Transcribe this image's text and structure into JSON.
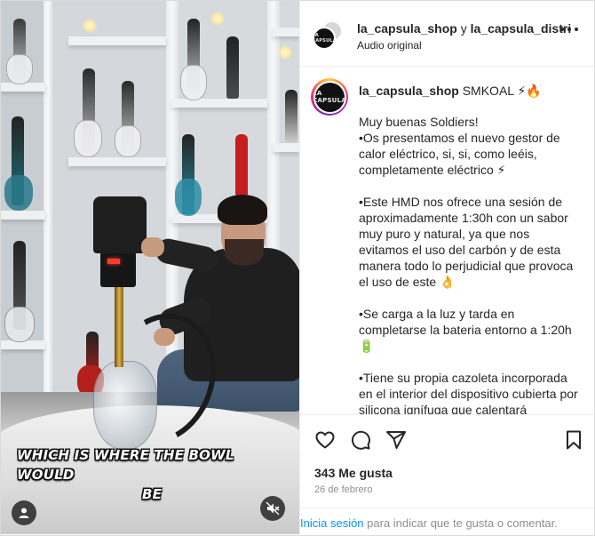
{
  "header": {
    "usernames": "la_capsula_shop",
    "joiner": " y ",
    "second_user": "la_capsula_distri",
    "audio": "Audio original"
  },
  "avatar": {
    "label": "LA CAPSULA"
  },
  "comment": {
    "username": "la_capsula_shop",
    "tag": "SMKOAL",
    "tag_emojis": "⚡🔥",
    "paragraphs": [
      "Muy buenas Soldiers!",
      "•Os presentamos el nuevo gestor de calor eléctrico, si, si, como leéis, completamente eléctrico ⚡",
      "•Este HMD nos ofrece una sesión de aproximadamente 1:30h con un sabor muy puro y natural, ya que nos evitamos el uso del carbón y de esta manera todo lo perjudicial que provoca el uso de este 👌",
      "•Se carga a la luz y tarda en completarse la bateria entorno a 1:20h 🔋",
      "•Tiene su propia cazoleta incorporada en el interior del dispositivo cubierta por silicona ignífuga que calentará"
    ]
  },
  "video": {
    "caption_line1": "WHICH IS WHERE THE BOWL WOULD",
    "caption_line2": "BE"
  },
  "actions": {
    "likes": "343 Me gusta",
    "date": "26 de febrero",
    "icons": [
      "heart-icon",
      "comment-icon",
      "share-icon",
      "bookmark-icon"
    ]
  },
  "login": {
    "link": "Inicia sesión",
    "rest": " para indicar que te gusta o comentar."
  },
  "colors": {
    "link": "#0095f6",
    "muted": "#8e8e8e",
    "text": "#262626"
  }
}
